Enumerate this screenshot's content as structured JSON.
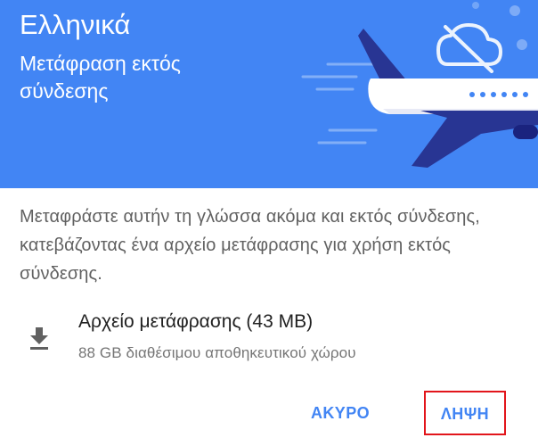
{
  "header": {
    "language": "Ελληνικά",
    "subtitle": "Μετάφραση εκτός σύνδεσης",
    "illustration_icon": "airplane-offline-illustration",
    "background_color": "#4285f4"
  },
  "body": {
    "description": "Μεταφράστε αυτήν τη γλώσσα ακόμα και εκτός σύνδεσης, κατεβάζοντας ένα αρχείο μετάφρασης για χρήση εκτός σύνδεσης."
  },
  "file": {
    "icon": "download-icon",
    "title": "Αρχείο μετάφρασης (43 MB)",
    "storage": "88 GB διαθέσιμου αποθηκευτικού χώρου"
  },
  "actions": {
    "cancel_label": "ΑΚΥΡΟ",
    "download_label": "ΛΗΨΗ",
    "accent_color": "#4285f4",
    "highlight_color": "#e2151b"
  }
}
